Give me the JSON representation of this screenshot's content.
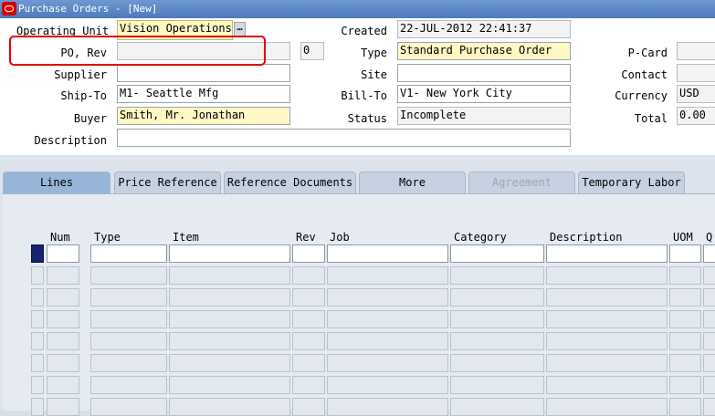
{
  "window": {
    "title": "Purchase Orders - [New]"
  },
  "header": {
    "operating_unit_label": "Operating Unit",
    "operating_unit_value": "Vision Operations",
    "lov_button": "…",
    "po_rev_label": "PO, Rev",
    "po_value": "",
    "rev_value": "0",
    "supplier_label": "Supplier",
    "supplier_value": "",
    "ship_to_label": "Ship-To",
    "ship_to_value": "M1- Seattle Mfg",
    "buyer_label": "Buyer",
    "buyer_value": "Smith, Mr. Jonathan",
    "description_label": "Description",
    "description_value": "",
    "created_label": "Created",
    "created_value": "22-JUL-2012 22:41:37",
    "type_label": "Type",
    "type_value": "Standard Purchase Order",
    "site_label": "Site",
    "site_value": "",
    "bill_to_label": "Bill-To",
    "bill_to_value": "V1- New York City",
    "status_label": "Status",
    "status_value": "Incomplete",
    "pcard_label": "P-Card",
    "pcard_value": "",
    "contact_label": "Contact",
    "contact_value": "",
    "currency_label": "Currency",
    "currency_value": "USD",
    "total_label": "Total",
    "total_value": "0.00"
  },
  "tabs": [
    {
      "label": "Lines",
      "state": "active"
    },
    {
      "label": "Price Reference",
      "state": "normal"
    },
    {
      "label": "Reference Documents",
      "state": "normal"
    },
    {
      "label": "More",
      "state": "normal"
    },
    {
      "label": "Agreement",
      "state": "disabled"
    },
    {
      "label": "Temporary Labor",
      "state": "normal"
    }
  ],
  "lines_table": {
    "columns": [
      "Num",
      "Type",
      "Item",
      "Rev",
      "Job",
      "Category",
      "Description",
      "UOM",
      "Q"
    ],
    "row_count": 8
  },
  "colors": {
    "required_field": "#fff7c4",
    "current_row_indicator": "#16236e",
    "highlight_box": "#e00000"
  }
}
